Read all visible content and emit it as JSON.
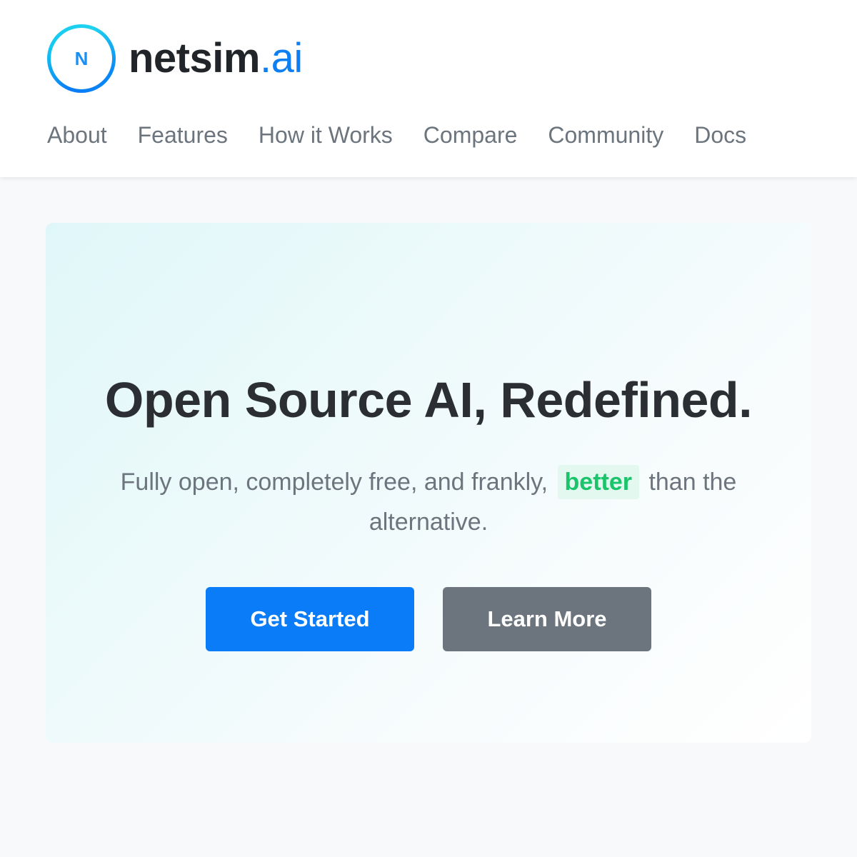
{
  "brand": {
    "logo_letter": "N",
    "name": "netsim",
    "tld": ".ai"
  },
  "nav": {
    "items": [
      "About",
      "Features",
      "How it Works",
      "Compare",
      "Community",
      "Docs"
    ]
  },
  "hero": {
    "title": "Open Source AI, Redefined.",
    "subtitle_before": "Fully open, completely free, and frankly,",
    "subtitle_highlight": "better",
    "subtitle_after": "than the alternative.",
    "primary_button": "Get Started",
    "secondary_button": "Learn More"
  },
  "colors": {
    "accent": "#0a7cf7",
    "highlight_text": "#19c46b",
    "secondary_button": "#6c757d"
  }
}
